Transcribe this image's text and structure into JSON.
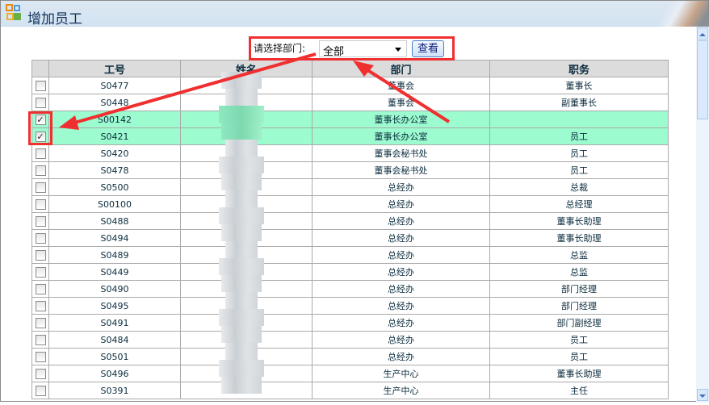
{
  "window": {
    "title": "增加员工"
  },
  "filter": {
    "label": "请选择部门:",
    "selected": "全部",
    "view_button": "查看"
  },
  "table": {
    "headers": [
      "工号",
      "姓名",
      "部门",
      "职务"
    ],
    "rows": [
      {
        "id": "S0477",
        "dept": "董事会",
        "title": "董事长",
        "checked": false
      },
      {
        "id": "S0448",
        "dept": "董事会",
        "title": "副董事长",
        "checked": false
      },
      {
        "id": "S00142",
        "dept": "董事长办公室",
        "title": "",
        "checked": true
      },
      {
        "id": "S0421",
        "dept": "董事长办公室",
        "title": "员工",
        "checked": true
      },
      {
        "id": "S0420",
        "dept": "董事会秘书处",
        "title": "员工",
        "checked": false
      },
      {
        "id": "S0478",
        "dept": "董事会秘书处",
        "title": "员工",
        "checked": false
      },
      {
        "id": "S0500",
        "dept": "总经办",
        "title": "总裁",
        "checked": false
      },
      {
        "id": "S00100",
        "dept": "总经办",
        "title": "总经理",
        "checked": false
      },
      {
        "id": "S0488",
        "dept": "总经办",
        "title": "董事长助理",
        "checked": false
      },
      {
        "id": "S0494",
        "dept": "总经办",
        "title": "董事长助理",
        "checked": false
      },
      {
        "id": "S0489",
        "dept": "总经办",
        "title": "总监",
        "checked": false
      },
      {
        "id": "S0449",
        "dept": "总经办",
        "title": "总监",
        "checked": false
      },
      {
        "id": "S0490",
        "dept": "总经办",
        "title": "部门经理",
        "checked": false
      },
      {
        "id": "S0495",
        "dept": "总经办",
        "title": "部门经理",
        "checked": false
      },
      {
        "id": "S0491",
        "dept": "总经办",
        "title": "部门副经理",
        "checked": false
      },
      {
        "id": "S0484",
        "dept": "总经办",
        "title": "员工",
        "checked": false
      },
      {
        "id": "S0501",
        "dept": "总经办",
        "title": "员工",
        "checked": false
      },
      {
        "id": "S0496",
        "dept": "生产中心",
        "title": "董事长助理",
        "checked": false
      },
      {
        "id": "S0391",
        "dept": "生产中心",
        "title": "主任",
        "checked": false
      }
    ]
  },
  "colors": {
    "highlight": "#9cfbcf",
    "annotation": "#f03030"
  }
}
